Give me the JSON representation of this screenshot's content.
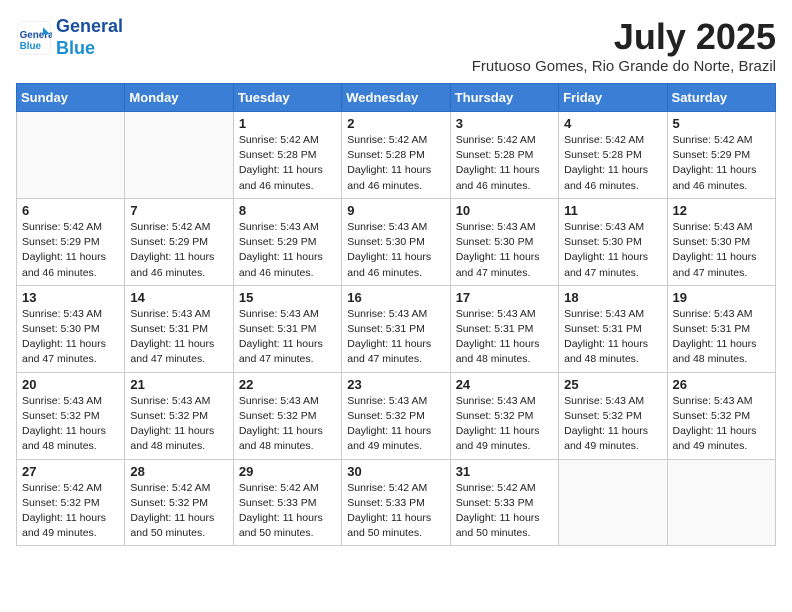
{
  "header": {
    "logo_line1": "General",
    "logo_line2": "Blue",
    "month": "July 2025",
    "location": "Frutuoso Gomes, Rio Grande do Norte, Brazil"
  },
  "days_of_week": [
    "Sunday",
    "Monday",
    "Tuesday",
    "Wednesday",
    "Thursday",
    "Friday",
    "Saturday"
  ],
  "weeks": [
    [
      {
        "day": null,
        "info": null
      },
      {
        "day": null,
        "info": null
      },
      {
        "day": "1",
        "info": "Sunrise: 5:42 AM\nSunset: 5:28 PM\nDaylight: 11 hours and 46 minutes."
      },
      {
        "day": "2",
        "info": "Sunrise: 5:42 AM\nSunset: 5:28 PM\nDaylight: 11 hours and 46 minutes."
      },
      {
        "day": "3",
        "info": "Sunrise: 5:42 AM\nSunset: 5:28 PM\nDaylight: 11 hours and 46 minutes."
      },
      {
        "day": "4",
        "info": "Sunrise: 5:42 AM\nSunset: 5:28 PM\nDaylight: 11 hours and 46 minutes."
      },
      {
        "day": "5",
        "info": "Sunrise: 5:42 AM\nSunset: 5:29 PM\nDaylight: 11 hours and 46 minutes."
      }
    ],
    [
      {
        "day": "6",
        "info": "Sunrise: 5:42 AM\nSunset: 5:29 PM\nDaylight: 11 hours and 46 minutes."
      },
      {
        "day": "7",
        "info": "Sunrise: 5:42 AM\nSunset: 5:29 PM\nDaylight: 11 hours and 46 minutes."
      },
      {
        "day": "8",
        "info": "Sunrise: 5:43 AM\nSunset: 5:29 PM\nDaylight: 11 hours and 46 minutes."
      },
      {
        "day": "9",
        "info": "Sunrise: 5:43 AM\nSunset: 5:30 PM\nDaylight: 11 hours and 46 minutes."
      },
      {
        "day": "10",
        "info": "Sunrise: 5:43 AM\nSunset: 5:30 PM\nDaylight: 11 hours and 47 minutes."
      },
      {
        "day": "11",
        "info": "Sunrise: 5:43 AM\nSunset: 5:30 PM\nDaylight: 11 hours and 47 minutes."
      },
      {
        "day": "12",
        "info": "Sunrise: 5:43 AM\nSunset: 5:30 PM\nDaylight: 11 hours and 47 minutes."
      }
    ],
    [
      {
        "day": "13",
        "info": "Sunrise: 5:43 AM\nSunset: 5:30 PM\nDaylight: 11 hours and 47 minutes."
      },
      {
        "day": "14",
        "info": "Sunrise: 5:43 AM\nSunset: 5:31 PM\nDaylight: 11 hours and 47 minutes."
      },
      {
        "day": "15",
        "info": "Sunrise: 5:43 AM\nSunset: 5:31 PM\nDaylight: 11 hours and 47 minutes."
      },
      {
        "day": "16",
        "info": "Sunrise: 5:43 AM\nSunset: 5:31 PM\nDaylight: 11 hours and 47 minutes."
      },
      {
        "day": "17",
        "info": "Sunrise: 5:43 AM\nSunset: 5:31 PM\nDaylight: 11 hours and 48 minutes."
      },
      {
        "day": "18",
        "info": "Sunrise: 5:43 AM\nSunset: 5:31 PM\nDaylight: 11 hours and 48 minutes."
      },
      {
        "day": "19",
        "info": "Sunrise: 5:43 AM\nSunset: 5:31 PM\nDaylight: 11 hours and 48 minutes."
      }
    ],
    [
      {
        "day": "20",
        "info": "Sunrise: 5:43 AM\nSunset: 5:32 PM\nDaylight: 11 hours and 48 minutes."
      },
      {
        "day": "21",
        "info": "Sunrise: 5:43 AM\nSunset: 5:32 PM\nDaylight: 11 hours and 48 minutes."
      },
      {
        "day": "22",
        "info": "Sunrise: 5:43 AM\nSunset: 5:32 PM\nDaylight: 11 hours and 48 minutes."
      },
      {
        "day": "23",
        "info": "Sunrise: 5:43 AM\nSunset: 5:32 PM\nDaylight: 11 hours and 49 minutes."
      },
      {
        "day": "24",
        "info": "Sunrise: 5:43 AM\nSunset: 5:32 PM\nDaylight: 11 hours and 49 minutes."
      },
      {
        "day": "25",
        "info": "Sunrise: 5:43 AM\nSunset: 5:32 PM\nDaylight: 11 hours and 49 minutes."
      },
      {
        "day": "26",
        "info": "Sunrise: 5:43 AM\nSunset: 5:32 PM\nDaylight: 11 hours and 49 minutes."
      }
    ],
    [
      {
        "day": "27",
        "info": "Sunrise: 5:42 AM\nSunset: 5:32 PM\nDaylight: 11 hours and 49 minutes."
      },
      {
        "day": "28",
        "info": "Sunrise: 5:42 AM\nSunset: 5:32 PM\nDaylight: 11 hours and 50 minutes."
      },
      {
        "day": "29",
        "info": "Sunrise: 5:42 AM\nSunset: 5:33 PM\nDaylight: 11 hours and 50 minutes."
      },
      {
        "day": "30",
        "info": "Sunrise: 5:42 AM\nSunset: 5:33 PM\nDaylight: 11 hours and 50 minutes."
      },
      {
        "day": "31",
        "info": "Sunrise: 5:42 AM\nSunset: 5:33 PM\nDaylight: 11 hours and 50 minutes."
      },
      {
        "day": null,
        "info": null
      },
      {
        "day": null,
        "info": null
      }
    ]
  ]
}
